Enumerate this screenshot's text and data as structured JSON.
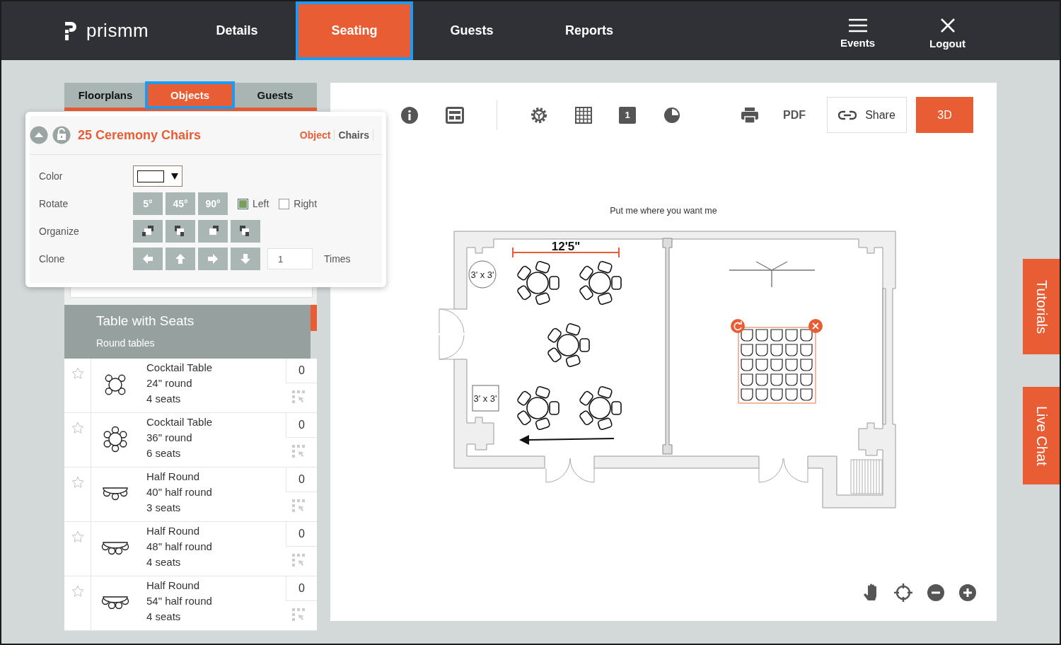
{
  "brand": {
    "name": "prismm"
  },
  "nav": [
    {
      "label": "Details",
      "selected": false
    },
    {
      "label": "Seating",
      "selected": true
    },
    {
      "label": "Guests",
      "selected": false
    },
    {
      "label": "Reports",
      "selected": false
    }
  ],
  "header_actions": [
    {
      "label": "Events",
      "kind": "menu"
    },
    {
      "label": "Logout",
      "kind": "close"
    }
  ],
  "side_tabs": [
    {
      "label": "Floorplans",
      "selected": false
    },
    {
      "label": "Objects",
      "selected": true
    },
    {
      "label": "Guests",
      "selected": false
    }
  ],
  "object_panel": {
    "title": "25 Ceremony Chairs",
    "tabs": [
      {
        "label": "Object",
        "selected": true
      },
      {
        "label": "Chairs",
        "selected": false
      }
    ],
    "color_label": "Color",
    "rotate_label": "Rotate",
    "rotate_steps": [
      "5°",
      "45°",
      "90°"
    ],
    "directions": [
      {
        "label": "Left",
        "checked": true
      },
      {
        "label": "Right",
        "checked": false
      }
    ],
    "organize_label": "Organize",
    "clone_label": "Clone",
    "clone_count": "1",
    "times_label": "Times"
  },
  "category": {
    "title": "Table with Seats",
    "subtitle": "Round tables"
  },
  "items": [
    {
      "name": "Cocktail Table",
      "size": "24\" round",
      "seats": "4 seats",
      "count": "0",
      "kind": "round4"
    },
    {
      "name": "Cocktail Table",
      "size": "36\" round",
      "seats": "6 seats",
      "count": "0",
      "kind": "round6"
    },
    {
      "name": "Half Round",
      "size": "40\" half round",
      "seats": "3 seats",
      "count": "0",
      "kind": "half3"
    },
    {
      "name": "Half Round",
      "size": "48\" half round",
      "seats": "4 seats",
      "count": "0",
      "kind": "half4"
    },
    {
      "name": "Half Round",
      "size": "54\" half round",
      "seats": "4 seats",
      "count": "0",
      "kind": "half4"
    }
  ],
  "toolbar": {
    "page_number": "1",
    "pdf": "PDF",
    "share": "Share",
    "view_3d": "3D"
  },
  "canvas": {
    "hint": "Put me where you want me",
    "dimension": "12'5\"",
    "object_labels": [
      "3' x 3'",
      "3' x 3'"
    ]
  },
  "side_buttons": [
    "Tutorials",
    "Live Chat"
  ]
}
